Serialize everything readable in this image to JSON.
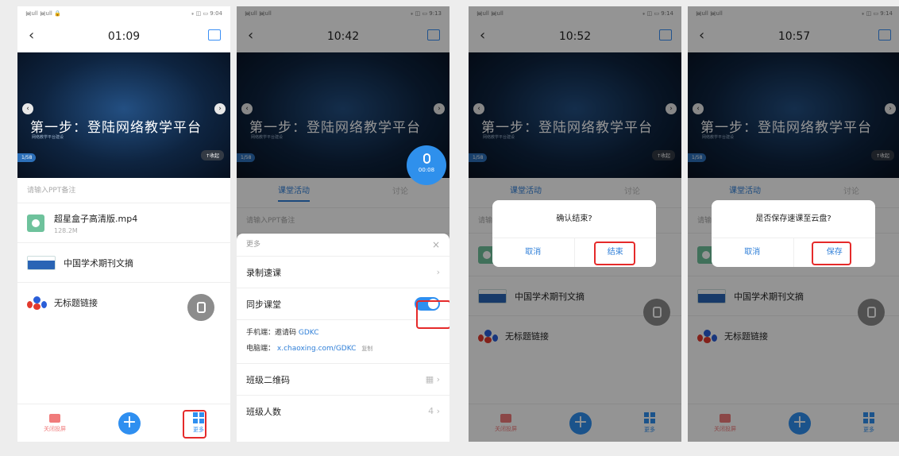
{
  "common": {
    "slide_title": "第一步：登陆网络教学平台",
    "slide_subtitle": "网络教学平台建设",
    "page_indicator": "1/58",
    "collapse_label": "↑收起",
    "ppt_note_placeholder": "请输入PPT备注",
    "arrow_left": "‹",
    "arrow_right": "›",
    "back": "‹"
  },
  "phone1": {
    "time": "01:09",
    "status_left": "᯼ull ᯼ull 🔒",
    "status_right": "⁎ ◫ ▭ 9:04",
    "items": [
      {
        "title": "超星盒子高清版.mp4",
        "sub": "128.2M"
      },
      {
        "title": "中国学术期刊文摘",
        "sub": ""
      },
      {
        "title": "无标题链接",
        "sub": ""
      }
    ],
    "bottom": {
      "projection": "关闭投屏",
      "more": "更多"
    }
  },
  "phone2": {
    "time": "10:42",
    "status_left": "᯼ull ᯼ull",
    "status_right": "⁎ ◫ ▭ 9:13",
    "tabs": [
      "课堂活动",
      "讨论"
    ],
    "mic_time": "00:08",
    "sheet": {
      "header": "更多",
      "close": "×",
      "record": "录制速课",
      "sync": "同步课堂",
      "phone_label": "手机端：邀请码",
      "invite_code": "GDKC",
      "pc_label": "电脑端：",
      "pc_link": "x.chaoxing.com/GDKC",
      "copy": "复制",
      "qrcode": "班级二维码",
      "count_label": "班级人数",
      "count_value": "4"
    }
  },
  "phone3": {
    "time": "10:52",
    "status_left": "᯼ull ᯼ull",
    "status_right": "⁎ ◫ ▭ 9:14",
    "tabs": [
      "课堂活动",
      "讨论"
    ],
    "dialog": {
      "title": "确认结束?",
      "cancel": "取消",
      "confirm": "结束"
    },
    "items": [
      {
        "title": "中国学术期刊文摘"
      },
      {
        "title": "无标题链接"
      }
    ],
    "bottom": {
      "projection": "关闭投屏",
      "more": "更多"
    }
  },
  "phone4": {
    "time": "10:57",
    "status_left": "᯼ull ᯼ull",
    "status_right": "⁎ ◫ ▭ 9:14",
    "tabs": [
      "课堂活动",
      "讨论"
    ],
    "dialog": {
      "title": "是否保存速课至云盘?",
      "cancel": "取消",
      "confirm": "保存"
    },
    "items": [
      {
        "title": "中国学术期刊文摘"
      },
      {
        "title": "无标题链接"
      }
    ],
    "bottom": {
      "projection": "关闭投屏",
      "more": "更多"
    }
  },
  "colors": {
    "accent": "#2f8ff0",
    "highlight": "#e52a2a",
    "slide_bg": "#0e2440"
  }
}
